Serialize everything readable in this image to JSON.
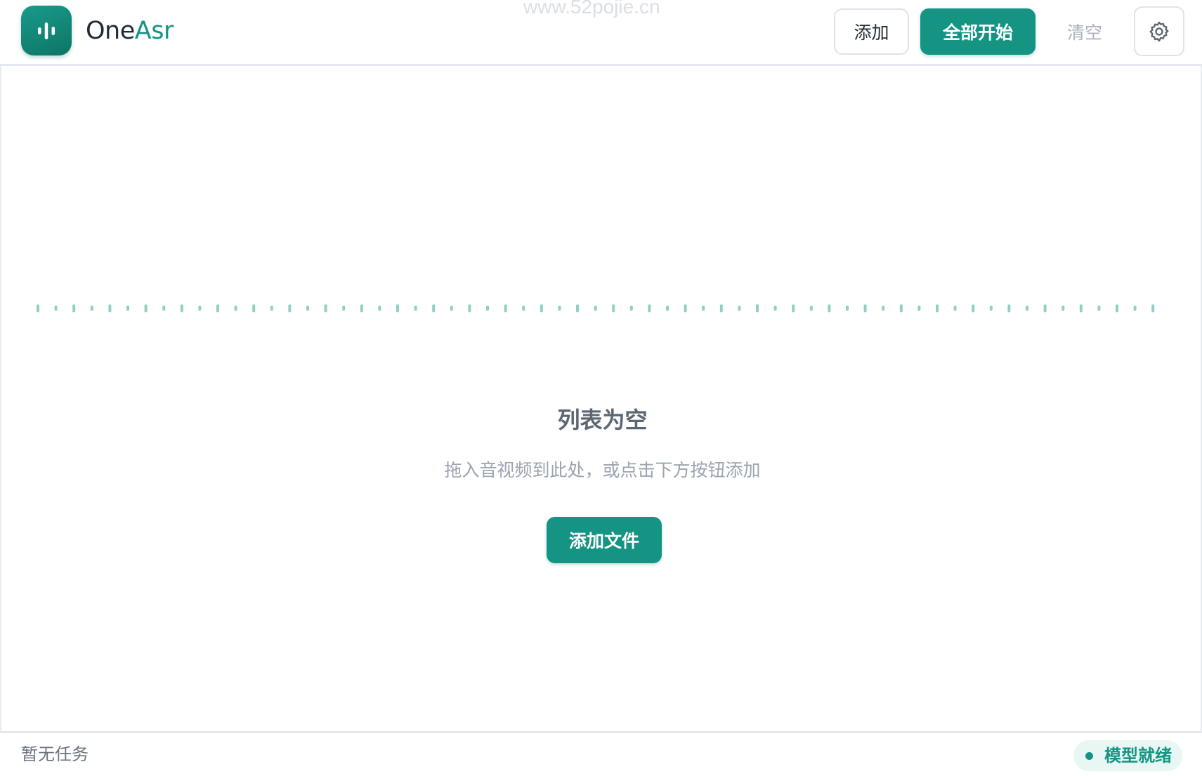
{
  "app": {
    "brand_one": "One",
    "brand_asr": "Asr",
    "accent_color": "#159484",
    "logo_icon": "sound-wave-icon",
    "watermark": "www.52pojie.cn"
  },
  "toolbar": {
    "add_label": "添加",
    "start_all_label": "全部开始",
    "clear_label": "清空",
    "settings_icon": "gear-icon"
  },
  "empty_state": {
    "title": "列表为空",
    "hint": "拖入音视频到此处，或点击下方按钮添加",
    "add_file_label": "添加文件",
    "decoration_icon": "dotted-waveform-line"
  },
  "status_bar": {
    "task_status": "暂无任务",
    "model_status": "模型就绪",
    "model_status_color": "#159484"
  }
}
